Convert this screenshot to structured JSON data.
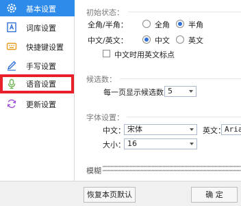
{
  "sidebar": {
    "items": [
      {
        "label": "基本设置",
        "icon": "gear-icon",
        "state": "selected"
      },
      {
        "label": "词库设置",
        "icon": "dictionary-icon"
      },
      {
        "label": "快捷键设置",
        "icon": "keyboard-icon"
      },
      {
        "label": "手写设置",
        "icon": "pen-icon"
      },
      {
        "label": "语音设置",
        "icon": "microphone-icon",
        "state": "highlighted"
      },
      {
        "label": "更新设置",
        "icon": "refresh-icon"
      }
    ]
  },
  "initial_state": {
    "title": "初始状态：",
    "width_label": "全角/半角：",
    "full_width": "全角",
    "half_width": "半角",
    "selected_width": "半角",
    "lang_label": "中文/英文：",
    "chinese": "中文",
    "english": "英文",
    "selected_lang": "中文",
    "punct_label": "中文时用英文标点",
    "punct_checked": false
  },
  "candidates": {
    "title": "候选数：",
    "count_label": "每一页显示候选数：",
    "count_value": "5"
  },
  "font": {
    "title": "字体设置：",
    "chinese_label": "中文：",
    "chinese_value": "宋体",
    "english_label": "英文：",
    "english_value": "Arial",
    "size_label": "大小：",
    "size_value": "16"
  },
  "fuzzy": {
    "title": "模糊"
  },
  "footer": {
    "restore_label": "恢复本页默认",
    "ok_label": "确 定"
  },
  "colors": {
    "accent": "#2f8bea",
    "highlight_border": "#e8202a"
  }
}
